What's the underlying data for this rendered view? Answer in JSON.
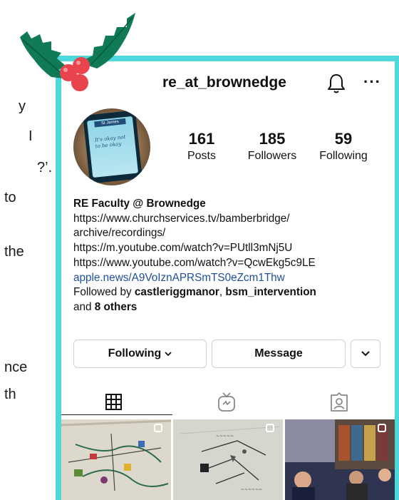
{
  "background_slide": {
    "fragments": [
      "y",
      "I",
      "?’.",
      "to",
      "the",
      "nce",
      "th"
    ]
  },
  "profile": {
    "username": "re_at_brownedge",
    "avatar_caption": "St James",
    "avatar_words": "It's okay not to be okay",
    "stats": [
      {
        "value": "161",
        "label": "Posts"
      },
      {
        "value": "185",
        "label": "Followers"
      },
      {
        "value": "59",
        "label": "Following"
      }
    ],
    "bio": {
      "name": "RE Faculty @ Brownedge",
      "lines": [
        "https://www.churchservices.tv/bamberbridge/",
        "archive/recordings/",
        "https://m.youtube.com/watch?v=PUtll3mNj5U",
        "https://www.youtube.com/watch?v=QcwEkg5c9LE"
      ],
      "link": "apple.news/A9VoIznAPRSmTS0eZcm1Thw",
      "followed_prefix": "Followed by ",
      "follower1": "castleriggmanor",
      "separator": ", ",
      "follower2": "bsm_intervention",
      "and_prefix": "and ",
      "others": "8 others"
    },
    "buttons": {
      "following": "Following",
      "message": "Message"
    }
  },
  "icons": [
    "bell-icon",
    "more-icon",
    "chevron-down-icon",
    "grid-icon",
    "igtv-icon",
    "tagged-icon",
    "multi-post-icon",
    "holly-icon"
  ],
  "colors": {
    "frame": "#4fd8dc",
    "link": "#1f4f9c",
    "holly_leaf": "#0f7a55",
    "holly_berry": "#e9434e"
  }
}
